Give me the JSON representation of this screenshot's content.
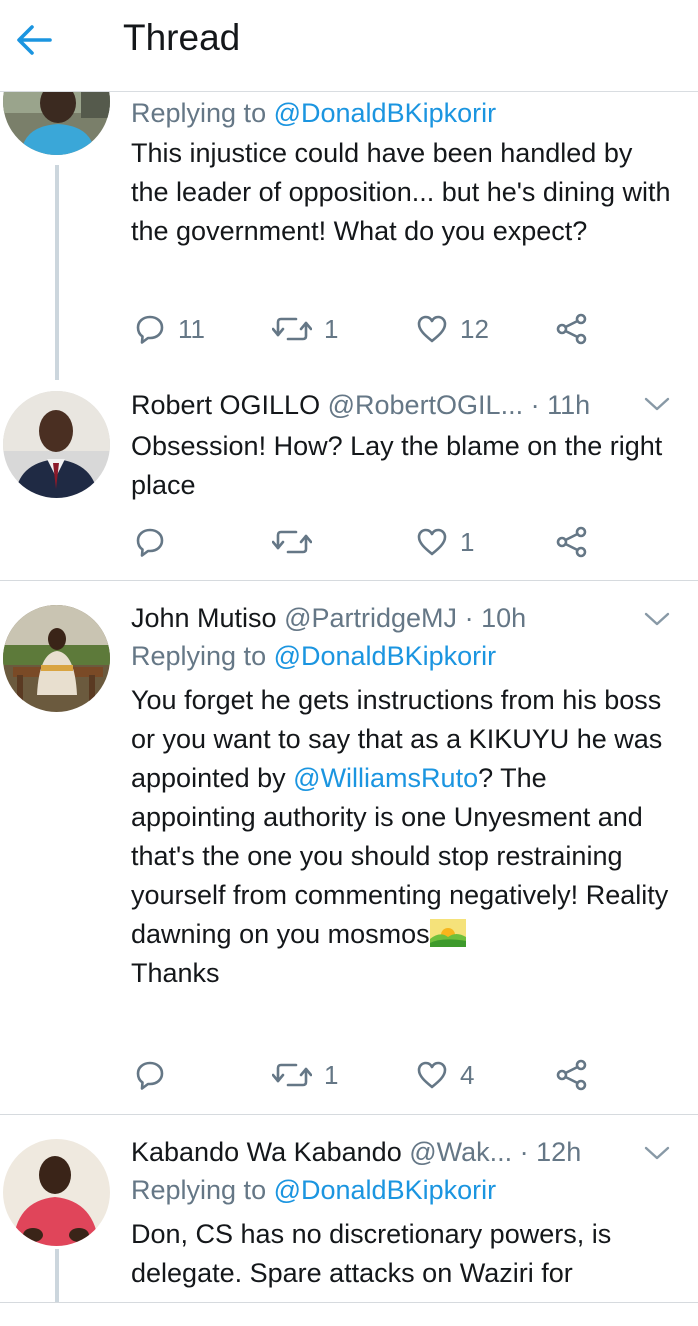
{
  "header": {
    "title": "Thread"
  },
  "tweets": [
    {
      "replying_prefix": "Replying to ",
      "replying_to": "@DonaldBKipkorir",
      "text": "This injustice could have been handled by the leader of opposition... but he's dining with the government! What do you expect?",
      "replies": "11",
      "retweets": "1",
      "likes": "12"
    },
    {
      "name": "Robert OGILLO",
      "handle": "@RobertOGIL...",
      "time": "· 11h",
      "text": "Obsession! How? Lay the blame on the right place",
      "replies": "",
      "retweets": "",
      "likes": "1"
    },
    {
      "name": "John Mutiso",
      "handle": "@PartridgeMJ",
      "time": "· 10h",
      "replying_prefix": "Replying to ",
      "replying_to": "@DonaldBKipkorir",
      "text_1": "You forget he gets instructions from his boss or you want to say that as a KIKUYU he was appointed by",
      "mention": "@WilliamsRuto",
      "text_2": "? The appointing authority is one Unyesment and that's the one you should stop restraining yourself from commenting negatively! Reality dawning on you mosmos",
      "text_3": "Thanks",
      "replies": "",
      "retweets": "1",
      "likes": "4"
    },
    {
      "name": "Kabando Wa Kabando",
      "handle": "@Wak...",
      "time": "· 12h",
      "replying_prefix": "Replying to ",
      "replying_to": "@DonaldBKipkorir",
      "text": "Don, CS has no discretionary powers, is delegate. Spare attacks on Waziri for"
    }
  ],
  "colors": {
    "accent": "#1b95e0",
    "secondary_text": "#657786",
    "primary_text": "#14171a",
    "divider": "#d6dade"
  },
  "icons": [
    "back-arrow-icon",
    "reply-icon",
    "retweet-icon",
    "like-icon",
    "share-icon",
    "chevron-down-icon",
    "sunrise-emoji"
  ]
}
